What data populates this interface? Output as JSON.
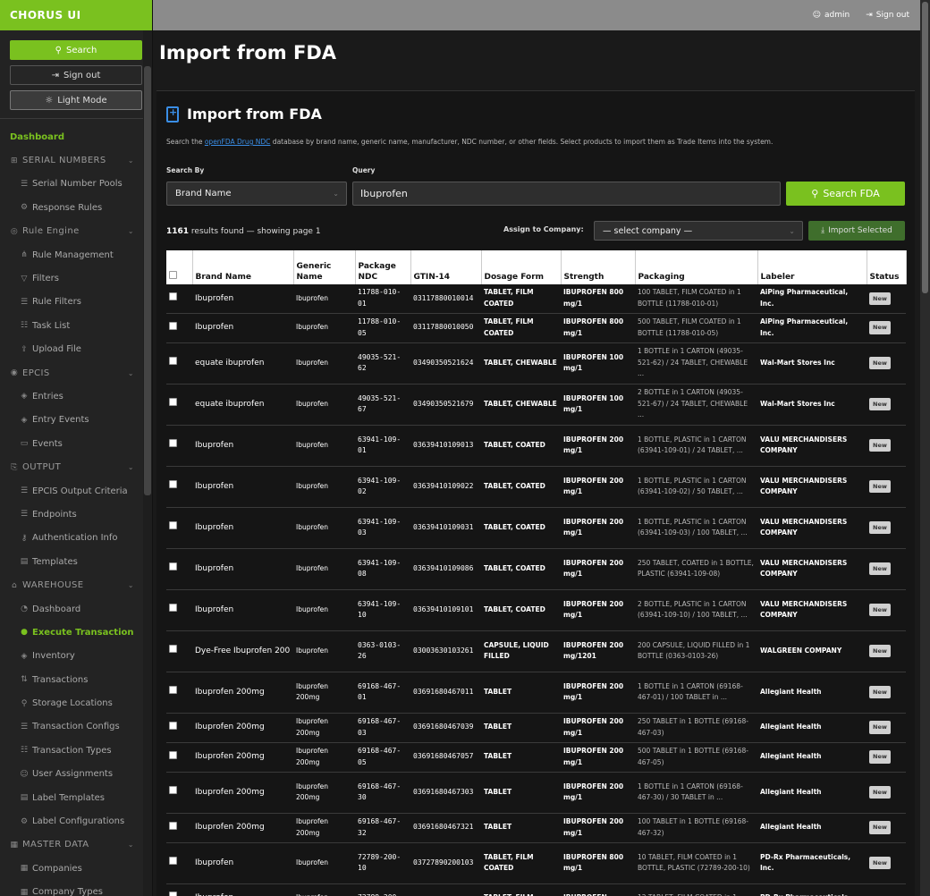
{
  "sidebar": {
    "brand": "CHORUS UI",
    "search_button": "Search",
    "signout_button": "Sign out",
    "light_mode_button": "Light Mode",
    "menu": [
      {
        "kind": "top",
        "label": "Dashboard",
        "icon": ""
      },
      {
        "kind": "section",
        "label": "SERIAL NUMBERS",
        "icon": "⊞"
      },
      {
        "kind": "item",
        "label": "Serial Number Pools",
        "icon": "☰"
      },
      {
        "kind": "item",
        "label": "Response Rules",
        "icon": "⚙"
      },
      {
        "kind": "section",
        "label": "Rule Engine",
        "icon": "◎"
      },
      {
        "kind": "item",
        "label": "Rule Management",
        "icon": "⋔"
      },
      {
        "kind": "item",
        "label": "Filters",
        "icon": "▽"
      },
      {
        "kind": "item",
        "label": "Rule Filters",
        "icon": "☰"
      },
      {
        "kind": "item",
        "label": "Task List",
        "icon": "☷"
      },
      {
        "kind": "item",
        "label": "Upload File",
        "icon": "⇪"
      },
      {
        "kind": "section",
        "label": "EPCIS",
        "icon": "◉"
      },
      {
        "kind": "item",
        "label": "Entries",
        "icon": "◈"
      },
      {
        "kind": "item",
        "label": "Entry Events",
        "icon": "◈"
      },
      {
        "kind": "item",
        "label": "Events",
        "icon": "▭"
      },
      {
        "kind": "section",
        "label": "OUTPUT",
        "icon": "⎘"
      },
      {
        "kind": "item",
        "label": "EPCIS Output Criteria",
        "icon": "☰"
      },
      {
        "kind": "item",
        "label": "Endpoints",
        "icon": "☰"
      },
      {
        "kind": "item",
        "label": "Authentication Info",
        "icon": "⚷"
      },
      {
        "kind": "item",
        "label": "Templates",
        "icon": "▤"
      },
      {
        "kind": "section",
        "label": "WAREHOUSE",
        "icon": "⌂"
      },
      {
        "kind": "item",
        "label": "Dashboard",
        "icon": "◔"
      },
      {
        "kind": "active",
        "label": "Execute Transaction",
        "icon": "●"
      },
      {
        "kind": "item",
        "label": "Inventory",
        "icon": "◈"
      },
      {
        "kind": "item",
        "label": "Transactions",
        "icon": "⇅"
      },
      {
        "kind": "item",
        "label": "Storage Locations",
        "icon": "⚲"
      },
      {
        "kind": "item",
        "label": "Transaction Configs",
        "icon": "☰"
      },
      {
        "kind": "item",
        "label": "Transaction Types",
        "icon": "☷"
      },
      {
        "kind": "item",
        "label": "User Assignments",
        "icon": "☺"
      },
      {
        "kind": "item",
        "label": "Label Templates",
        "icon": "▤"
      },
      {
        "kind": "item",
        "label": "Label Configurations",
        "icon": "⚙"
      },
      {
        "kind": "section",
        "label": "MASTER DATA",
        "icon": "▦"
      },
      {
        "kind": "item",
        "label": "Companies",
        "icon": "▦"
      },
      {
        "kind": "item",
        "label": "Company Types",
        "icon": "▦"
      }
    ]
  },
  "topbar": {
    "user": "admin",
    "signout": "Sign out"
  },
  "main": {
    "page_title": "Import from FDA",
    "card_title": "Import from FDA",
    "desc_before": "Search the ",
    "desc_link": "openFDA Drug NDC",
    "desc_after": " database by brand name, generic name, manufacturer, NDC number, or other fields. Select products to import them as Trade Items into the system.",
    "search_by_label": "Search By",
    "search_by_value": "Brand Name",
    "query_label": "Query",
    "query_value": "Ibuprofen",
    "search_button": "Search FDA",
    "results_count": "1161",
    "results_text": " results found — showing page 1",
    "assign_label": "Assign to Company:",
    "company_placeholder": "— select company —",
    "import_button": "Import Selected"
  },
  "table": {
    "headers": [
      "",
      "Brand Name",
      "Generic Name",
      "Package NDC",
      "GTIN-14",
      "Dosage Form",
      "Strength",
      "Packaging",
      "Labeler",
      "Status"
    ],
    "rows": [
      {
        "brand": "Ibuprofen",
        "generic": "Ibuprofen",
        "ndc": "11788-010-01",
        "gtin": "03117880010014",
        "form": "TABLET, FILM COATED",
        "strength": "IBUPROFEN 800 mg/1",
        "pack": "100 TABLET, FILM COATED in 1 BOTTLE (11788-010-01)",
        "labeler": "AiPing Pharmaceutical, Inc.",
        "status": "New",
        "h": 32
      },
      {
        "brand": "Ibuprofen",
        "generic": "Ibuprofen",
        "ndc": "11788-010-05",
        "gtin": "03117880010050",
        "form": "TABLET, FILM COATED",
        "strength": "IBUPROFEN 800 mg/1",
        "pack": "500 TABLET, FILM COATED in 1 BOTTLE (11788-010-05)",
        "labeler": "AiPing Pharmaceutical, Inc.",
        "status": "New",
        "h": 33
      },
      {
        "brand": "equate ibuprofen",
        "generic": "Ibuprofen",
        "ndc": "49035-521-62",
        "gtin": "03490350521624",
        "form": "TABLET, CHEWABLE",
        "strength": "IBUPROFEN 100 mg/1",
        "pack": "1 BOTTLE in 1 CARTON (49035-521-62) / 24 TABLET, CHEWABLE ...",
        "labeler": "Wal-Mart Stores Inc",
        "status": "New",
        "h": 46
      },
      {
        "brand": "equate ibuprofen",
        "generic": "Ibuprofen",
        "ndc": "49035-521-67",
        "gtin": "03490350521679",
        "form": "TABLET, CHEWABLE",
        "strength": "IBUPROFEN 100 mg/1",
        "pack": "2 BOTTLE in 1 CARTON (49035-521-67) / 24 TABLET, CHEWABLE ...",
        "labeler": "Wal-Mart Stores Inc",
        "status": "New",
        "h": 46
      },
      {
        "brand": "Ibuprofen",
        "generic": "Ibuprofen",
        "ndc": "63941-109-01",
        "gtin": "03639410109013",
        "form": "TABLET, COATED",
        "strength": "IBUPROFEN 200 mg/1",
        "pack": "1 BOTTLE, PLASTIC in 1 CARTON (63941-109-01) / 24 TABLET, ...",
        "labeler": "VALU MERCHANDISERS COMPANY",
        "status": "New",
        "h": 46
      },
      {
        "brand": "Ibuprofen",
        "generic": "Ibuprofen",
        "ndc": "63941-109-02",
        "gtin": "03639410109022",
        "form": "TABLET, COATED",
        "strength": "IBUPROFEN 200 mg/1",
        "pack": "1 BOTTLE, PLASTIC in 1 CARTON (63941-109-02) / 50 TABLET, ...",
        "labeler": "VALU MERCHANDISERS COMPANY",
        "status": "New",
        "h": 46
      },
      {
        "brand": "Ibuprofen",
        "generic": "Ibuprofen",
        "ndc": "63941-109-03",
        "gtin": "03639410109031",
        "form": "TABLET, COATED",
        "strength": "IBUPROFEN 200 mg/1",
        "pack": "1 BOTTLE, PLASTIC in 1 CARTON (63941-109-03) / 100 TABLET, ...",
        "labeler": "VALU MERCHANDISERS COMPANY",
        "status": "New",
        "h": 46
      },
      {
        "brand": "Ibuprofen",
        "generic": "Ibuprofen",
        "ndc": "63941-109-08",
        "gtin": "03639410109086",
        "form": "TABLET, COATED",
        "strength": "IBUPROFEN 200 mg/1",
        "pack": "250 TABLET, COATED in 1 BOTTLE, PLASTIC (63941-109-08)",
        "labeler": "VALU MERCHANDISERS COMPANY",
        "status": "New",
        "h": 46
      },
      {
        "brand": "Ibuprofen",
        "generic": "Ibuprofen",
        "ndc": "63941-109-10",
        "gtin": "03639410109101",
        "form": "TABLET, COATED",
        "strength": "IBUPROFEN 200 mg/1",
        "pack": "2 BOTTLE, PLASTIC in 1 CARTON (63941-109-10) / 100 TABLET, ...",
        "labeler": "VALU MERCHANDISERS COMPANY",
        "status": "New",
        "h": 46
      },
      {
        "brand": "Dye-Free Ibuprofen 200",
        "generic": "Ibuprofen",
        "ndc": "0363-0103-26",
        "gtin": "03003630103261",
        "form": "CAPSULE, LIQUID FILLED",
        "strength": "IBUPROFEN 200 mg/1201",
        "pack": "200 CAPSULE, LIQUID FILLED in 1 BOTTLE (0363-0103-26)",
        "labeler": "WALGREEN COMPANY",
        "status": "New",
        "h": 46
      },
      {
        "brand": "Ibuprofen 200mg",
        "generic": "Ibuprofen 200mg",
        "ndc": "69168-467-01",
        "gtin": "03691680467011",
        "form": "TABLET",
        "strength": "IBUPROFEN 200 mg/1",
        "pack": "1 BOTTLE in 1 CARTON (69168-467-01) / 100 TABLET in ...",
        "labeler": "Allegiant Health",
        "status": "New",
        "h": 46
      },
      {
        "brand": "Ibuprofen 200mg",
        "generic": "Ibuprofen 200mg",
        "ndc": "69168-467-03",
        "gtin": "03691680467039",
        "form": "TABLET",
        "strength": "IBUPROFEN 200 mg/1",
        "pack": "250 TABLET in 1 BOTTLE (69168-467-03)",
        "labeler": "Allegiant Health",
        "status": "New",
        "h": 33
      },
      {
        "brand": "Ibuprofen 200mg",
        "generic": "Ibuprofen 200mg",
        "ndc": "69168-467-05",
        "gtin": "03691680467057",
        "form": "TABLET",
        "strength": "IBUPROFEN 200 mg/1",
        "pack": "500 TABLET in 1 BOTTLE (69168-467-05)",
        "labeler": "Allegiant Health",
        "status": "New",
        "h": 33
      },
      {
        "brand": "Ibuprofen 200mg",
        "generic": "Ibuprofen 200mg",
        "ndc": "69168-467-30",
        "gtin": "03691680467303",
        "form": "TABLET",
        "strength": "IBUPROFEN 200 mg/1",
        "pack": "1 BOTTLE in 1 CARTON (69168-467-30) / 30 TABLET in ...",
        "labeler": "Allegiant Health",
        "status": "New",
        "h": 46
      },
      {
        "brand": "Ibuprofen 200mg",
        "generic": "Ibuprofen 200mg",
        "ndc": "69168-467-32",
        "gtin": "03691680467321",
        "form": "TABLET",
        "strength": "IBUPROFEN 200 mg/1",
        "pack": "100 TABLET in 1 BOTTLE (69168-467-32)",
        "labeler": "Allegiant Health",
        "status": "New",
        "h": 33
      },
      {
        "brand": "Ibuprofen",
        "generic": "Ibuprofen",
        "ndc": "72789-200-10",
        "gtin": "03727890200103",
        "form": "TABLET, FILM COATED",
        "strength": "IBUPROFEN 800 mg/1",
        "pack": "10 TABLET, FILM COATED in 1 BOTTLE, PLASTIC (72789-200-10)",
        "labeler": "PD-Rx Pharmaceuticals, Inc.",
        "status": "New",
        "h": 46
      },
      {
        "brand": "Ibuprofen",
        "generic": "Ibuprofen",
        "ndc": "72789-200-",
        "gtin": "",
        "form": "TABLET, FILM",
        "strength": "IBUPROFEN",
        "pack": "12 TABLET, FILM COATED in 1",
        "labeler": "PD-Rx Pharmaceuticals",
        "status": "",
        "h": 32
      }
    ]
  }
}
